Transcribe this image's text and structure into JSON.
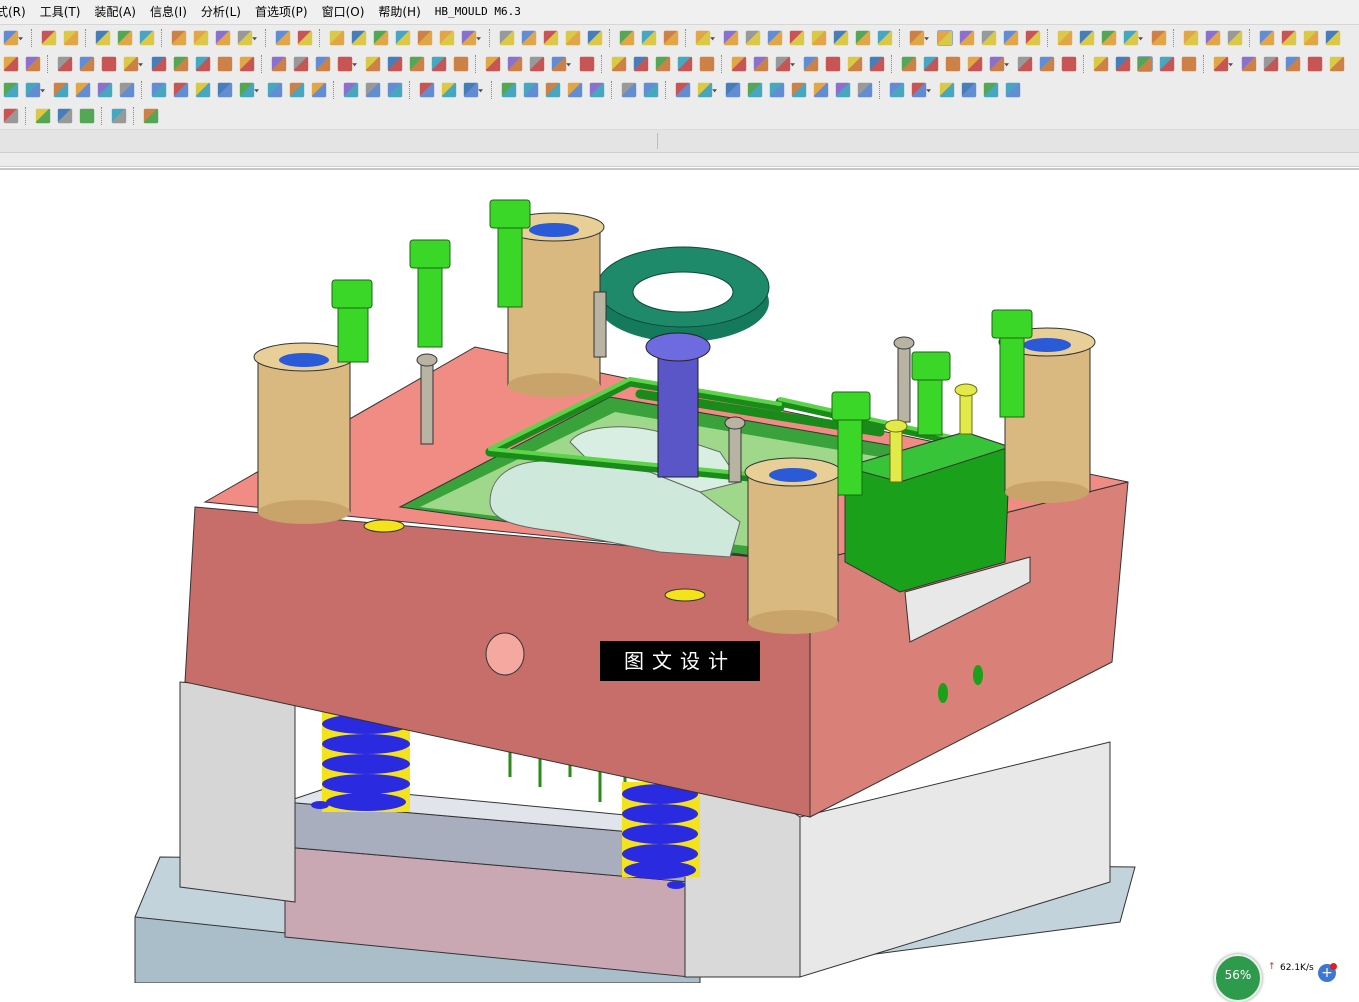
{
  "menu": {
    "items": [
      "式(R)",
      "工具(T)",
      "装配(A)",
      "信息(I)",
      "分析(L)",
      "首选项(P)",
      "窗口(O)",
      "帮助(H)"
    ],
    "app_label": "HB_MOULD M6.3"
  },
  "viewport": {
    "watermark": "图文设计",
    "model": "injection-mould-assembly"
  },
  "taskbar_widget": {
    "percent": "56%",
    "speed": "62.1K/s",
    "plus": "+"
  },
  "colors": {
    "plate_top": "#f08c84",
    "plate_front": "#c86e6a",
    "support_block": "#d4d4d4",
    "guide_bush": "#d9b97f",
    "screw_green": "#3ad628",
    "spring_blue": "#2a2ae0",
    "spring_yellow": "#f4e21a",
    "locating_ring": "#1f8a6a",
    "sprue_bush": "#5a56c8",
    "slider_block": "#1aa01a"
  }
}
